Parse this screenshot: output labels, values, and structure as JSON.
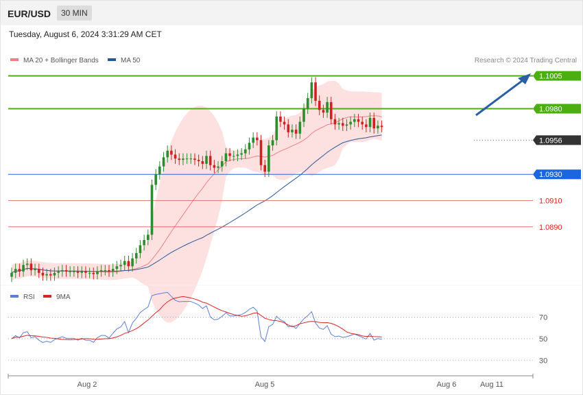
{
  "header": {
    "symbol": "EUR/USD",
    "timeframe": "30 MIN",
    "datetime": "Tuesday, August 6, 2024 3:31:29 AM CET"
  },
  "legend": {
    "ma20": "MA 20 + Bollinger Bands",
    "ma50": "MA 50",
    "credit": "Research © 2024 Trading Central",
    "rsi": "RSI",
    "rsi_ma": "9MA"
  },
  "colors": {
    "bull": "#2e8b2e",
    "bear": "#cc2222",
    "bb_fill": "#fde0e0",
    "ma20": "#f08080",
    "ma50": "#2b5797",
    "resistance": "#4caf10",
    "support_blue": "#1a66e0",
    "support_red": "#e05555",
    "arrow": "#2b5ea8"
  },
  "chart_data": [
    {
      "type": "candlestick",
      "instrument": "EUR/USD",
      "timeframe": "30 MIN",
      "x_ticks": [
        "Aug 2",
        "Aug 5",
        "Aug 6",
        "Aug 11"
      ],
      "ylim": [
        1.0845,
        1.101
      ],
      "levels": [
        {
          "label": "1.1005",
          "value": 1.1005,
          "kind": "resistance"
        },
        {
          "label": "1.0980",
          "value": 1.098,
          "kind": "resistance"
        },
        {
          "label": "1.0956",
          "value": 1.0956,
          "kind": "last"
        },
        {
          "label": "1.0930",
          "value": 1.093,
          "kind": "pivot"
        },
        {
          "label": "1.0910",
          "value": 1.091,
          "kind": "support"
        },
        {
          "label": "1.0890",
          "value": 1.089,
          "kind": "support"
        }
      ],
      "close": [
        1.0855,
        1.0858,
        1.0856,
        1.0861,
        1.0862,
        1.0857,
        1.0858,
        1.0855,
        1.0853,
        1.0854,
        1.0853,
        1.0855,
        1.0856,
        1.0857,
        1.0856,
        1.0856,
        1.0856,
        1.0855,
        1.0856,
        1.0855,
        1.0855,
        1.0854,
        1.0856,
        1.0857,
        1.0857,
        1.0856,
        1.0858,
        1.086,
        1.0861,
        1.0864,
        1.086,
        1.0866,
        1.087,
        1.0876,
        1.088,
        1.0884,
        1.0922,
        1.093,
        1.0936,
        1.0943,
        1.0948,
        1.0945,
        1.0942,
        1.0941,
        1.0942,
        1.0942,
        1.0942,
        1.0941,
        1.094,
        1.0938,
        1.0944,
        1.0937,
        1.0935,
        1.0936,
        1.094,
        1.0946,
        1.0944,
        1.0944,
        1.0945,
        1.0946,
        1.0949,
        1.0954,
        1.0958,
        1.0956,
        1.0937,
        1.0932,
        1.0952,
        1.0956,
        1.0974,
        1.097,
        1.0968,
        1.0962,
        1.0964,
        1.0961,
        1.097,
        1.098,
        1.0988,
        1.1,
        1.0986,
        1.0979,
        1.0977,
        1.0985,
        1.0972,
        1.0968,
        1.0969,
        1.0967,
        1.0968,
        1.097,
        1.0972,
        1.097,
        1.0968,
        1.0966,
        1.0973,
        1.0965,
        1.0967,
        1.0966
      ],
      "bollinger": {
        "ma": 20,
        "bands": "shaded"
      },
      "ma_periods": [
        20,
        50
      ]
    },
    {
      "type": "line",
      "name": "RSI",
      "ylim": [
        20,
        85
      ],
      "levels": [
        70,
        50,
        30
      ],
      "series": [
        "RSI",
        "9MA"
      ]
    }
  ]
}
